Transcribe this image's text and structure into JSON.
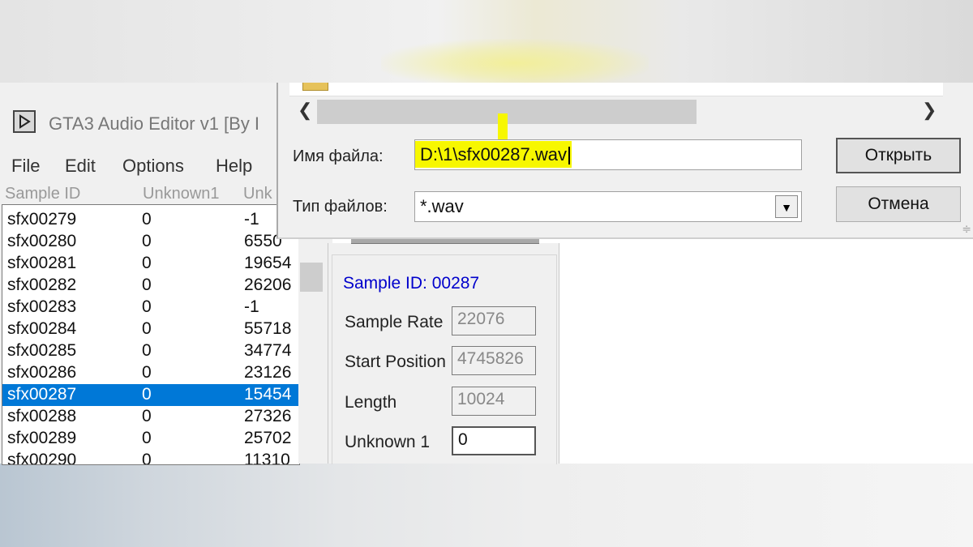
{
  "background": {
    "top_color": "#e6e6e6",
    "bottom_color": "#cfd6dd"
  },
  "editor": {
    "title": "GTA3 Audio Editor v1 [By I",
    "menu": [
      "File",
      "Edit",
      "Options",
      "Help"
    ],
    "columns": [
      "Sample ID",
      "Unknown1",
      "Unk"
    ],
    "rows": [
      {
        "id": "sfx00279",
        "unknown1": "0",
        "unk": "-1"
      },
      {
        "id": "sfx00280",
        "unknown1": "0",
        "unk": "6550"
      },
      {
        "id": "sfx00281",
        "unknown1": "0",
        "unk": "19654"
      },
      {
        "id": "sfx00282",
        "unknown1": "0",
        "unk": "26206"
      },
      {
        "id": "sfx00283",
        "unknown1": "0",
        "unk": "-1"
      },
      {
        "id": "sfx00284",
        "unknown1": "0",
        "unk": "55718"
      },
      {
        "id": "sfx00285",
        "unknown1": "0",
        "unk": "34774"
      },
      {
        "id": "sfx00286",
        "unknown1": "0",
        "unk": "23126"
      },
      {
        "id": "sfx00287",
        "unknown1": "0",
        "unk": "15454"
      },
      {
        "id": "sfx00288",
        "unknown1": "0",
        "unk": "27326"
      },
      {
        "id": "sfx00289",
        "unknown1": "0",
        "unk": "25702"
      },
      {
        "id": "sfx00290",
        "unknown1": "0",
        "unk": "11310"
      }
    ],
    "selected_row": "sfx00287",
    "selection_color": "#0078d7"
  },
  "panel": {
    "sample_id": "Sample ID: 00287",
    "sample_id_color": "#0000cc",
    "fields": [
      {
        "label": "Sample Rate",
        "value": "22076"
      },
      {
        "label": "Start Position",
        "value": "4745826"
      },
      {
        "label": "Length",
        "value": "10024"
      },
      {
        "label": "Unknown 1",
        "value": "0"
      }
    ]
  },
  "dialog": {
    "filename_label": "Имя файла:",
    "filename_value": "D:\\1\\sfx00287.wav",
    "filetype_label": "Тип файлов:",
    "filetype_value": "*.wav",
    "open_button": "Открыть",
    "cancel_button": "Отмена",
    "highlight_color": "#f7f700"
  }
}
